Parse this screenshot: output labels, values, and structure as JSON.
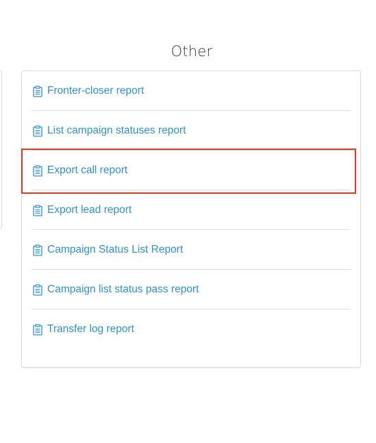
{
  "section": {
    "title": "Other"
  },
  "reports": [
    {
      "label": "Fronter-closer report",
      "icon": "clipboard-icon"
    },
    {
      "label": "List campaign statuses report",
      "icon": "clipboard-icon"
    },
    {
      "label": "Export call report",
      "icon": "clipboard-icon"
    },
    {
      "label": "Export lead report",
      "icon": "clipboard-icon"
    },
    {
      "label": "Campaign Status List Report",
      "icon": "clipboard-icon"
    },
    {
      "label": "Campaign list status pass report",
      "icon": "clipboard-icon"
    },
    {
      "label": "Transfer log report",
      "icon": "clipboard-icon"
    }
  ],
  "colors": {
    "link": "#2f8fd8",
    "highlight": "#f0321e",
    "title": "#333333",
    "divider": "#dedede"
  }
}
